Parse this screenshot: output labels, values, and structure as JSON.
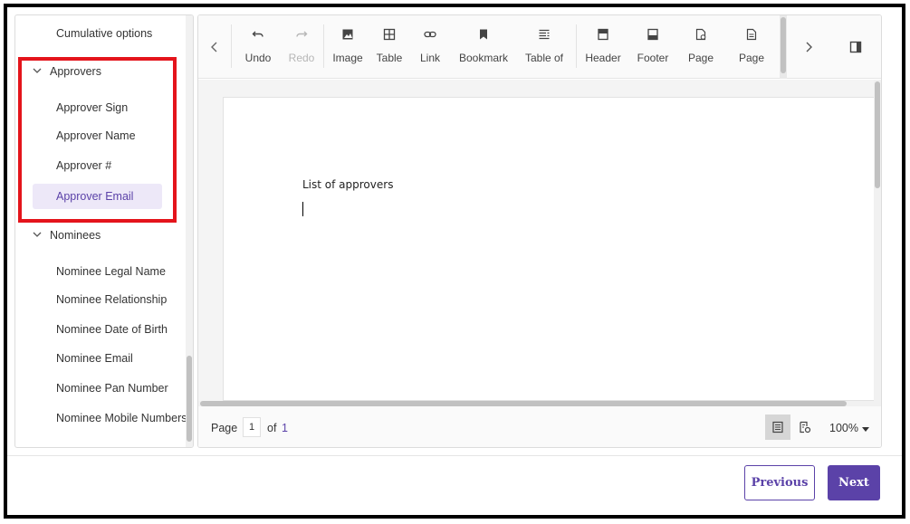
{
  "sidebar": {
    "cumulative": "Cumulative options",
    "approvers_group": "Approvers",
    "approver_items": [
      "Approver Sign",
      "Approver Name",
      "Approver #",
      "Approver Email"
    ],
    "nominees_group": "Nominees",
    "nominee_items": [
      "Nominee Legal Name",
      "Nominee Relationship",
      "Nominee Date of Birth",
      "Nominee Email",
      "Nominee Pan Number",
      "Nominee Mobile Numbers"
    ]
  },
  "toolbar": {
    "undo": "Undo",
    "redo": "Redo",
    "image": "Image",
    "table": "Table",
    "link": "Link",
    "bookmark": "Bookmark",
    "table_of": "Table of",
    "header": "Header",
    "footer": "Footer",
    "page1": "Page",
    "page2": "Page"
  },
  "document": {
    "text": "List of approvers"
  },
  "status": {
    "page_label": "Page",
    "page_current": "1",
    "of_label": "of",
    "page_total": "1",
    "zoom": "100%"
  },
  "footer": {
    "previous": "Previous",
    "next": "Next"
  },
  "colors": {
    "accent": "#5b42a8",
    "highlight": "#e4141b",
    "selected_bg": "#ede8f8"
  }
}
